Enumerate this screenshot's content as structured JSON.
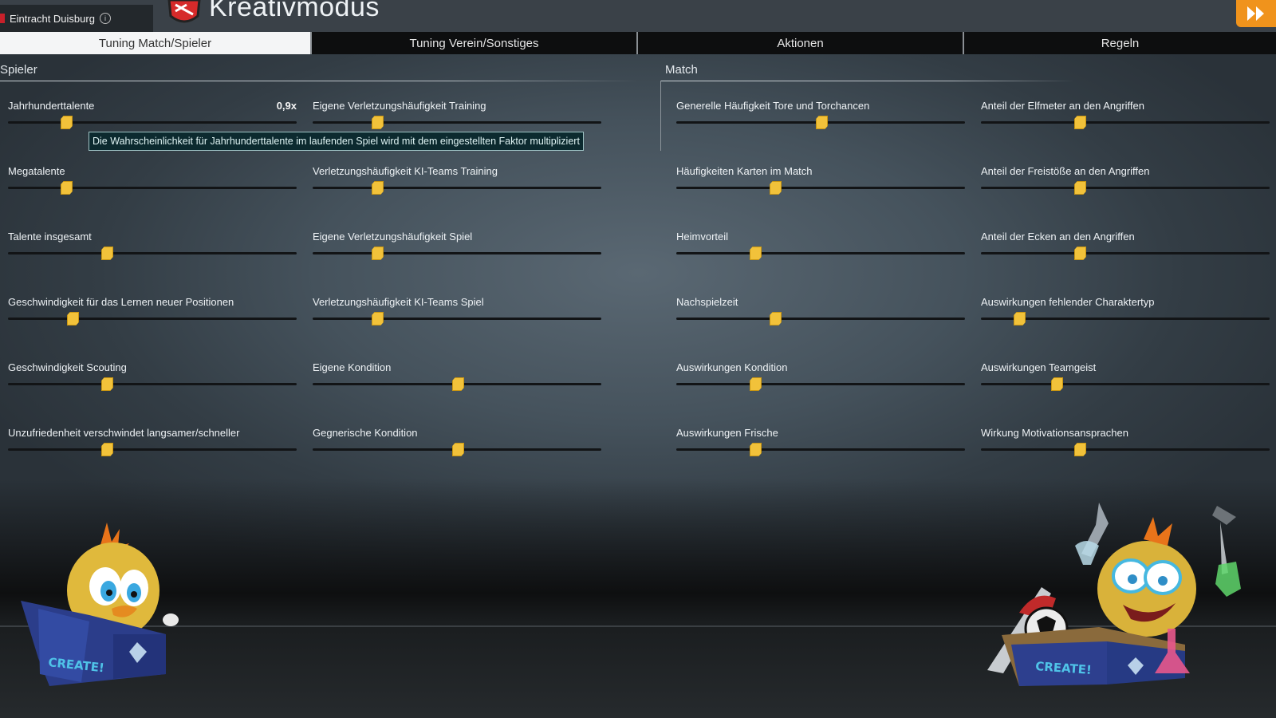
{
  "header": {
    "club_name": "Eintracht Duisburg",
    "title": "Kreativmodus"
  },
  "tabs": [
    {
      "label": "Tuning Match/Spieler",
      "active": true
    },
    {
      "label": "Tuning Verein/Sonstiges",
      "active": false
    },
    {
      "label": "Aktionen",
      "active": false
    },
    {
      "label": "Regeln",
      "active": false
    }
  ],
  "sections": {
    "spieler": "Spieler",
    "match": "Match"
  },
  "tooltip": "Die Wahrscheinlichkeit für Jahrhunderttalente im laufenden Spiel wird mit dem eingestellten Faktor multipliziert",
  "sliders": {
    "col1": [
      {
        "label": "Jahrhunderttalente",
        "value": "0,9x",
        "level": 0.2
      },
      {
        "label": "Megatalente",
        "value": "",
        "level": 0.2
      },
      {
        "label": "Talente insgesamt",
        "value": "",
        "level": 0.34
      },
      {
        "label": "Geschwindigkeit für das Lernen neuer Positionen",
        "value": "",
        "level": 0.22
      },
      {
        "label": "Geschwindigkeit Scouting",
        "value": "",
        "level": 0.34
      },
      {
        "label": "Unzufriedenheit verschwindet langsamer/schneller",
        "value": "",
        "level": 0.34
      }
    ],
    "col2": [
      {
        "label": "Eigene Verletzungshäufigkeit Training",
        "value": "",
        "level": 0.22
      },
      {
        "label": "Verletzungshäufigkeit KI-Teams Training",
        "value": "",
        "level": 0.22
      },
      {
        "label": "Eigene Verletzungshäufigkeit Spiel",
        "value": "",
        "level": 0.22
      },
      {
        "label": "Verletzungshäufigkeit KI-Teams Spiel",
        "value": "",
        "level": 0.22
      },
      {
        "label": "Eigene Kondition",
        "value": "",
        "level": 0.5
      },
      {
        "label": "Gegnerische Kondition",
        "value": "",
        "level": 0.5
      }
    ],
    "col3": [
      {
        "label": "Generelle Häufigkeit Tore und Torchancen",
        "value": "",
        "level": 0.5
      },
      {
        "label": "Häufigkeiten Karten im Match",
        "value": "",
        "level": 0.34
      },
      {
        "label": "Heimvorteil",
        "value": "",
        "level": 0.27
      },
      {
        "label": "Nachspielzeit",
        "value": "",
        "level": 0.34
      },
      {
        "label": "Auswirkungen Kondition",
        "value": "",
        "level": 0.27
      },
      {
        "label": "Auswirkungen Frische",
        "value": "",
        "level": 0.27
      }
    ],
    "col4": [
      {
        "label": "Anteil der Elfmeter an den Angriffen",
        "value": "",
        "level": 0.34
      },
      {
        "label": "Anteil der Freistöße an den Angriffen",
        "value": "",
        "level": 0.34
      },
      {
        "label": "Anteil der Ecken an den Angriffen",
        "value": "",
        "level": 0.34
      },
      {
        "label": "Auswirkungen fehlender Charaktertyp",
        "value": "",
        "level": 0.13
      },
      {
        "label": "Auswirkungen Teamgeist",
        "value": "",
        "level": 0.26
      },
      {
        "label": "Wirkung Motivationsansprachen",
        "value": "",
        "level": 0.34
      }
    ]
  },
  "mascots": {
    "box_text": "CREATE!"
  },
  "colors": {
    "accent": "#f0931c",
    "slider_thumb": "#f2c23a",
    "tab_active_bg": "#f4f5f6",
    "tab_bar_bg": "#0d0e0f"
  }
}
